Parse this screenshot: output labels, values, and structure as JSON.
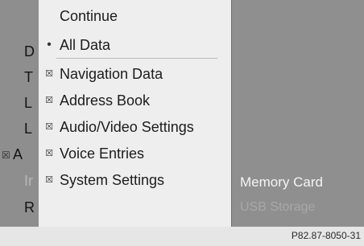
{
  "left_column": {
    "items": [
      {
        "letter": "D",
        "has_check": false
      },
      {
        "letter": "T",
        "has_check": false
      },
      {
        "letter": "L",
        "has_check": false
      },
      {
        "letter": "L",
        "has_check": false
      },
      {
        "letter": "A",
        "has_check": true
      },
      {
        "letter": "Ir",
        "has_check": false
      },
      {
        "letter": "R",
        "has_check": false
      }
    ],
    "check_glyph": "☒"
  },
  "menu": {
    "continue_label": "Continue",
    "items": [
      {
        "label": "All Data",
        "icon": "radio-dot",
        "glyph": "•"
      },
      {
        "label": "Navigation Data",
        "icon": "checkbox-checked",
        "glyph": "☒"
      },
      {
        "label": "Address Book",
        "icon": "checkbox-checked",
        "glyph": "☒"
      },
      {
        "label": "Audio/Video Settings",
        "icon": "checkbox-checked",
        "glyph": "☒"
      },
      {
        "label": "Voice Entries",
        "icon": "checkbox-checked",
        "glyph": "☒"
      },
      {
        "label": "System Settings",
        "icon": "checkbox-checked",
        "glyph": "☒"
      }
    ]
  },
  "background_panel": {
    "memory_card_label": "Memory Card",
    "usb_label": "USB Storage"
  },
  "footer": {
    "code": "P82.87-8050-31"
  },
  "colors": {
    "menu_bg": "#eeeeee",
    "screen_bg": "#8d8d8d",
    "text_dark": "#1c1c1c",
    "text_light": "#f4f4f4"
  }
}
